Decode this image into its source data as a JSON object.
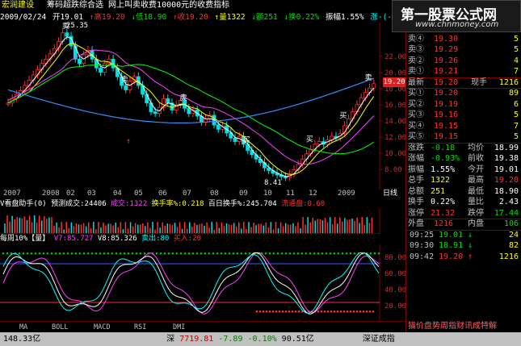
{
  "header": {
    "stock_name": "宏润建设",
    "tabs_text": "筹码超跌综合选  网上叫卖收费10000元的收费指标"
  },
  "price_bar": {
    "date": "2009/02/24",
    "open": "开19.01",
    "high": "↑高19.20",
    "low": "↓低18.90",
    "close": "↑收19.20",
    "volume": "↑量1322",
    "amount": "↓额251",
    "turnover": "↓换0.22%",
    "amplitude": "振幅1.55%",
    "change": "涨-(-0.18)-0.93%",
    "ma5": "MA5:18.848",
    "ma10": "MA10:18.968",
    "ma30": "MA30:17.398"
  },
  "main_chart": {
    "high_label": "25.35",
    "low_label": "8.41",
    "sell_label": "卖",
    "buy_label": "买",
    "current_price": "19.20",
    "price_axis": [
      "22.00",
      "20.00",
      "18.00",
      "16.00",
      "14.00",
      "12.00",
      "10.00",
      "8.00"
    ],
    "dates": [
      "2007",
      "2008",
      "02",
      "03",
      "04",
      "05",
      "06",
      "07",
      "08",
      "09",
      "10",
      "11",
      "12",
      "2009"
    ],
    "period_label": "日线"
  },
  "volume_bar": {
    "title": "V看盘助手(0)",
    "forecast": "预测成交:24406",
    "turnover_rate": "换手率%:0.218",
    "day100": "百日换手%:245.704",
    "text1": "成交:1322",
    "text2": "流通盘:0.60"
  },
  "osc_bar": {
    "title": "每周10%【量】",
    "v7": "V7:85.727",
    "v8": "V8:85.326",
    "sell_out": "卖出:80",
    "buy_in": "买入:20",
    "axis": [
      "80.00",
      "60.00",
      "40.00",
      "20.00"
    ]
  },
  "indicator_tabs": [
    "MA",
    "BOLL",
    "MACD",
    "RSI",
    "DMI"
  ],
  "quote_panel": {
    "asks": [
      {
        "label": "卖⑤",
        "price": "19.37",
        "vol": "1"
      },
      {
        "label": "卖④",
        "price": "19.30",
        "vol": "5"
      },
      {
        "label": "卖③",
        "price": "19.29",
        "vol": "5"
      },
      {
        "label": "卖②",
        "price": "19.26",
        "vol": "4"
      },
      {
        "label": "卖①",
        "price": "19.21",
        "vol": "7"
      }
    ],
    "latest": {
      "label": "最新",
      "price": "19.20",
      "label2": "现手",
      "vol": "1216"
    },
    "bids": [
      {
        "label": "买①",
        "price": "19.20",
        "vol": "89"
      },
      {
        "label": "买②",
        "price": "19.19",
        "vol": "6"
      },
      {
        "label": "买③",
        "price": "19.16",
        "vol": "5"
      },
      {
        "label": "买④",
        "price": "19.15",
        "vol": "7"
      },
      {
        "label": "买⑤",
        "price": "19.15",
        "vol": "5"
      }
    ],
    "stats": [
      {
        "l1": "涨跌",
        "v1": "-0.18",
        "l2": "均价",
        "v2": "18.99"
      },
      {
        "l1": "涨幅",
        "v1": "-0.93%",
        "l2": "前收",
        "v2": "19.38"
      },
      {
        "l1": "振幅",
        "v1": "1.55%",
        "l2": "今开",
        "v2": "19.01"
      },
      {
        "l1": "总手",
        "v1": "1322",
        "l2": "最高",
        "v2": "19.20"
      },
      {
        "l1": "总额",
        "v1": "251",
        "l2": "最低",
        "v2": "18.90"
      },
      {
        "l1": "换手",
        "v1": "0.22%",
        "l2": "量比",
        "v2": "2.43"
      },
      {
        "l1": "涨停",
        "v1": "21.32",
        "l2": "跌停",
        "v2": "17.44"
      }
    ],
    "outer": {
      "l1": "外盘",
      "v1": "1216",
      "l2": "内盘",
      "v2": "106"
    },
    "ticks": [
      {
        "time": "09:25",
        "price": "19.01",
        "arrow": "↓",
        "vol": "24"
      },
      {
        "time": "09:30",
        "price": "18.91",
        "arrow": "↓",
        "vol": "82"
      },
      {
        "time": "09:42",
        "price": "19.20",
        "arrow": "↑",
        "vol": "1216"
      }
    ]
  },
  "status_bar": {
    "left": "148.33亿",
    "market": "深",
    "index": "7719.81",
    "change": "-7.89",
    "amount": "-0.10%",
    "total": "90.51亿",
    "right": "深证成指"
  },
  "watermark": {
    "logo_main": "第一股票公式网",
    "logo_url": "www.chnmoney.com",
    "bottom": "猫价盘势周指财讯成特解"
  },
  "colors": {
    "up": "#ff3030",
    "down": "#00e0e0",
    "ma5": "#ffffff",
    "ma10": "#ffff00",
    "ma30": "#ff40ff",
    "ma60": "#00ff00"
  }
}
